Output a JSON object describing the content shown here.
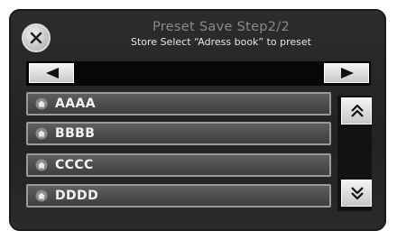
{
  "header": {
    "title": "Preset Save  Step2/2",
    "subtitle": "Store Select “Adress book” to preset"
  },
  "icons": {
    "close": "close-icon",
    "prev": "arrow-left-icon",
    "next": "arrow-right-icon",
    "scroll_up": "double-chevron-up-icon",
    "scroll_down": "double-chevron-down-icon",
    "entry": "house-icon"
  },
  "list": {
    "items": [
      {
        "label": "AAAA"
      },
      {
        "label": "BBBB"
      },
      {
        "label": "CCCC"
      },
      {
        "label": "DDDD"
      }
    ]
  },
  "colors": {
    "screen_bg": "#262626",
    "button_face": "#e0e0e0",
    "item_text": "#f2f2f2"
  }
}
